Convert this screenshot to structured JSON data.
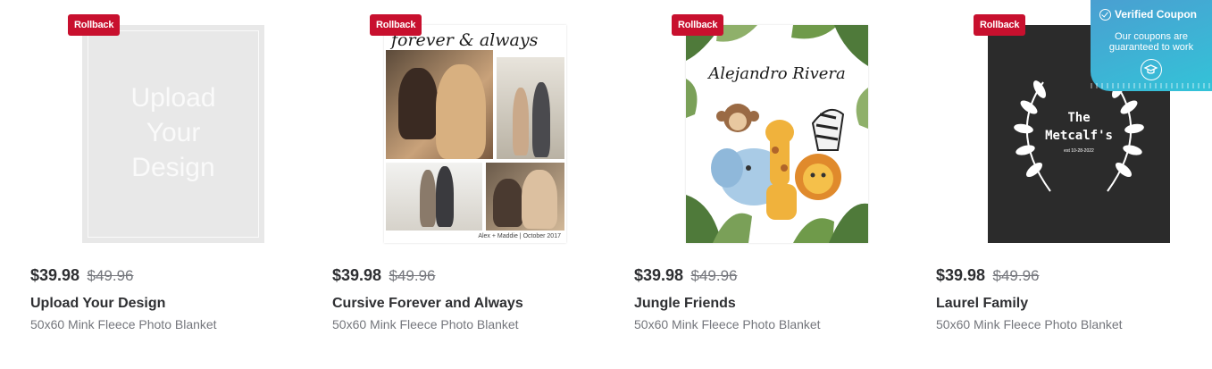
{
  "products": [
    {
      "badge": "Rollback",
      "price": "$39.98",
      "was_price": "$49.96",
      "title": "Upload Your Design",
      "subtitle": "50x60 Mink Fleece Photo Blanket",
      "thumb_text": [
        "Upload",
        "Your",
        "Design"
      ]
    },
    {
      "badge": "Rollback",
      "price": "$39.98",
      "was_price": "$49.96",
      "title": "Cursive Forever and Always",
      "subtitle": "50x60 Mink Fleece Photo Blanket",
      "thumb_script": "forever & always",
      "thumb_caption": "Alex + Maddie | October 2017"
    },
    {
      "badge": "Rollback",
      "price": "$39.98",
      "was_price": "$49.96",
      "title": "Jungle Friends",
      "subtitle": "50x60 Mink Fleece Photo Blanket",
      "thumb_name": "Alejandro Rivera"
    },
    {
      "badge": "Rollback",
      "price": "$39.98",
      "was_price": "$49.96",
      "title": "Laurel Family",
      "subtitle": "50x60 Mink Fleece Photo Blanket",
      "thumb_family": [
        "The",
        "Metcalf's"
      ],
      "thumb_est": "est 10-28-2022"
    }
  ],
  "coupon_widget": {
    "title": "Verified Coupon",
    "message": [
      "Our coupons are",
      "guaranteed to work"
    ],
    "icon": "graduation-cap-icon"
  },
  "colors": {
    "rollback_red": "#c8102e",
    "price_text": "#2e2f32",
    "muted_text": "#74767c",
    "coupon_gradient_start": "#4a9fd1",
    "coupon_gradient_end": "#33c3d8"
  }
}
